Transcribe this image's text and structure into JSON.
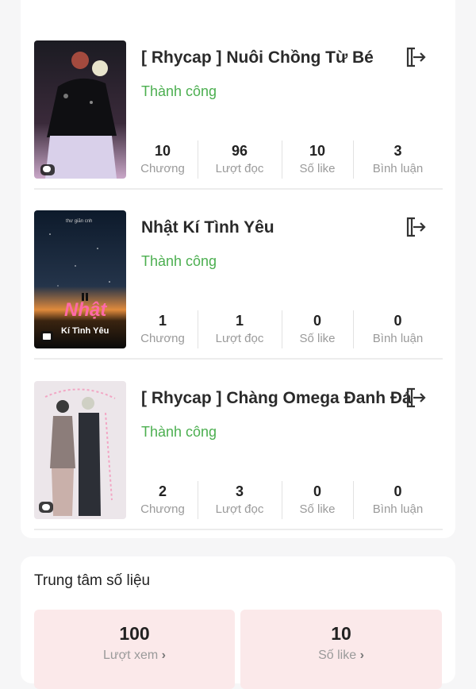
{
  "stories": [
    {
      "title": "[ Rhycap ] Nuôi Chồng Từ Bé",
      "status": "Thành công",
      "cover_icon": "chat-bubble-icon",
      "metrics": [
        {
          "value": "10",
          "label": "Chương"
        },
        {
          "value": "96",
          "label": "Lượt đọc"
        },
        {
          "value": "10",
          "label": "Số like"
        },
        {
          "value": "3",
          "label": "Bình luận"
        }
      ]
    },
    {
      "title": "Nhật Kí Tình Yêu",
      "status": "Thành công",
      "cover_icon": "book-icon",
      "cover_top_text": "thư giãn cnh",
      "cover_big_text": "Nhật",
      "cover_sub_text": "Kí Tình Yêu",
      "metrics": [
        {
          "value": "1",
          "label": "Chương"
        },
        {
          "value": "1",
          "label": "Lượt đọc"
        },
        {
          "value": "0",
          "label": "Số like"
        },
        {
          "value": "0",
          "label": "Bình luận"
        }
      ]
    },
    {
      "title": "[ Rhycap ] Chàng Omega Đanh Đá",
      "status": "Thành công",
      "cover_icon": "chat-bubble-icon",
      "metrics": [
        {
          "value": "2",
          "label": "Chương"
        },
        {
          "value": "3",
          "label": "Lượt đọc"
        },
        {
          "value": "0",
          "label": "Số like"
        },
        {
          "value": "0",
          "label": "Bình luận"
        }
      ]
    }
  ],
  "stats_center": {
    "heading": "Trung tâm số liệu",
    "items": [
      {
        "value": "100",
        "label": "Lượt xem"
      },
      {
        "value": "10",
        "label": "Số like"
      }
    ]
  },
  "colors": {
    "status_green": "#4caf50",
    "stat_box_bg": "#fbe9ea"
  }
}
